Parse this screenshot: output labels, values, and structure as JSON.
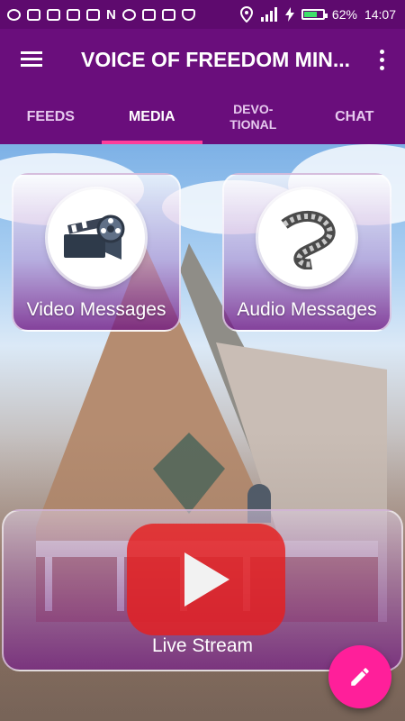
{
  "status_bar": {
    "battery": "62%",
    "time": "14:07",
    "battery_level": 0.62,
    "notification_icons": [
      "whatsapp-icon",
      "shirt-icon",
      "gmail-icon",
      "gmail-icon",
      "image-icon",
      "n-icon",
      "bird-icon",
      "instagram-icon",
      "mail-icon",
      "shield-icon"
    ],
    "system_icons": [
      "location-icon",
      "signal-icon",
      "charging-icon",
      "battery-icon"
    ]
  },
  "app_bar": {
    "title": "VOICE OF FREEDOM MIN...",
    "menu_icon": "hamburger-icon",
    "overflow_icon": "more-vert-icon"
  },
  "tabs": [
    {
      "label": "FEEDS",
      "active": false
    },
    {
      "label": "MEDIA",
      "active": true
    },
    {
      "label": "DEVO-\nTIONAL",
      "active": false
    },
    {
      "label": "CHAT",
      "active": false
    }
  ],
  "tiles": {
    "video": {
      "label": "Video Messages",
      "icon": "film-reel-icon"
    },
    "audio": {
      "label": "Audio Messages",
      "icon": "film-strip-icon"
    },
    "live": {
      "label": "Live Stream",
      "icon": "youtube-play-icon"
    }
  },
  "fab": {
    "icon": "pencil-icon"
  },
  "colors": {
    "primary": "#6a0e7c",
    "status_bar": "#5e0a6e",
    "accent": "#ff1f9a",
    "tab_indicator": "#ff3d9a"
  }
}
